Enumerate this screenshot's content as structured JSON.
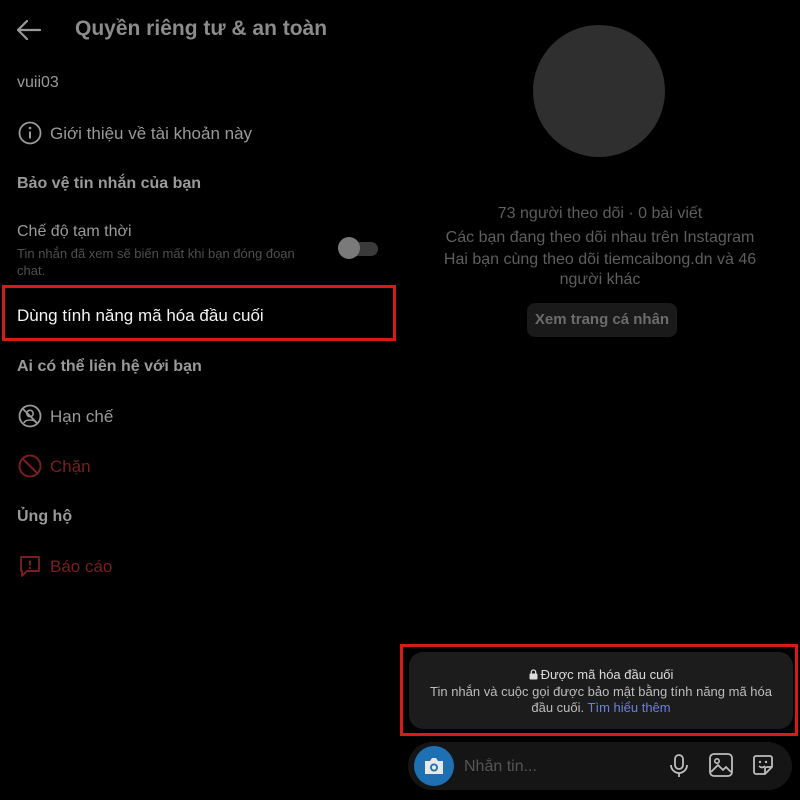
{
  "header": {
    "title": "Quyền riêng tư & an toàn"
  },
  "username": "vuii03",
  "about_label": "Giới thiệu về tài khoản này",
  "sections": {
    "protect_messages": "Bảo vệ tin nhắn của bạn",
    "who_can_contact": "Ai có thể liên hệ với bạn",
    "support": "Ủng hộ"
  },
  "vanish_mode": {
    "title": "Chế độ tạm thời",
    "description_line1": "Tin nhắn đã xem sẽ biến mất khi bạn đóng đoạn",
    "description_line2": "chat.",
    "enabled": false
  },
  "e2e_label": "Dùng tính năng mã hóa đầu cuối",
  "restrict_label": "Hạn chế",
  "block_label": "Chặn",
  "report_label": "Báo cáo",
  "profile": {
    "stats": "73 người theo dõi · 0 bài viết",
    "mutual": "Các bạn đang theo dõi nhau trên Instagram",
    "mutual_followers_line1": "Hai bạn cùng theo dõi tiemcaibong.dn và 46",
    "mutual_followers_line2": "người khác",
    "view_profile": "Xem trang cá nhân"
  },
  "notice": {
    "title": "Được mã hóa đầu cuối",
    "body_line1": "Tin nhắn và cuộc gọi được bảo mật bằng tính năng mã hóa",
    "body_line2": "đầu cuối.",
    "learn_more": "Tìm hiểu thêm"
  },
  "composer": {
    "placeholder": "Nhắn tin..."
  },
  "colors": {
    "highlight": "#d61b1b",
    "danger": "#7a1e1e",
    "camera": "#1f6fb3",
    "link": "#6b7fe0"
  }
}
